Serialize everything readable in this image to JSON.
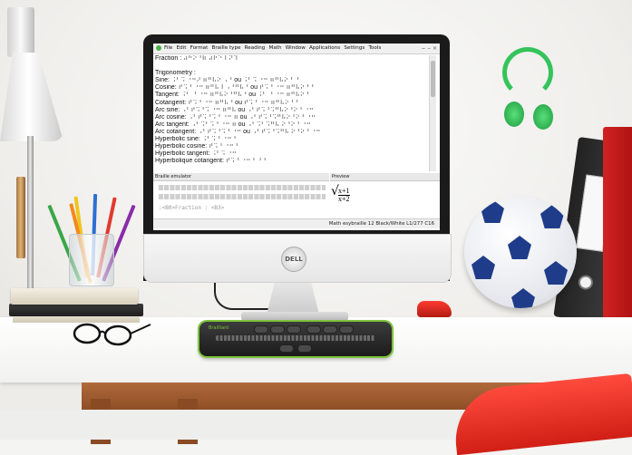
{
  "app": {
    "menu": [
      "File",
      "Edit",
      "Format",
      "Braille type",
      "Reading",
      "Math",
      "Window",
      "Applications",
      "Settings",
      "Tools"
    ],
    "window_controls": "− ‒ ×"
  },
  "editor_lines": [
    "Fraction : ⠴⠓⠕⠘⠷ ⠴⠗⠑⠸ ⠝⠹",
    "",
    "Trigonometry :",
    "Sine: ⠨⠃⠩ ⠐⠒⠜ ⠶⠛⠧⠕ ⠠⠘ ou ⠨⠃⠩ ⠐⠒ ⠶⠛⠧⠕⠘ ⠘",
    "Cosine: ⠞⠩⠘ ⠐⠒ ⠶⠛⠧⠸ ⠠⠘⠛⠧⠘ ou ⠞⠩⠘ ⠐⠒ ⠶⠛⠧⠕⠘⠘",
    "Tangent: ⠨⠃ ⠘ ⠐⠒ ⠶⠛⠧⠕⠘⠛⠧⠘ ou ⠨⠃ ⠘ ⠐⠒ ⠶⠛⠧⠕⠘",
    "Cotangent: ⠞⠩⠘ ⠐⠒ ⠶⠛⠧⠘ ou ⠞⠩⠘ ⠐⠒ ⠶⠛⠧⠕⠘⠘",
    "Arc sine: ⠠⠃⠞⠩⠘⠩ ⠐⠒ ⠶⠛⠧ ou ⠠⠃⠞⠩⠘⠩⠛⠧⠕⠘⠕⠘ ⠐⠒",
    "Arc cosine: ⠠⠃⠞⠩⠘⠩⠘ ⠐⠒ ⠶ ou ⠠⠃⠞⠩⠘⠩⠛⠧⠕⠘⠕⠘ ⠐⠒",
    "Arc tangent: ⠠⠃⠩⠃⠩⠘ ⠐⠒ ⠶ ou ⠠⠃⠩⠃⠩⠛⠧ ⠕⠘⠕⠘ ⠐⠒",
    "Arc cotangent: ⠠⠃⠞⠩⠘⠩⠘ ⠐⠒ ou ⠠⠃⠞⠩⠘⠩⠛⠧ ⠕⠘⠕⠘ ⠐⠒",
    "Hyperbolic sine: ⠨⠃⠩⠘ ⠐⠒⠘",
    "Hyperbolic cosine: ⠞⠩⠘ ⠐⠒⠘",
    "Hyperbolic tangent: ⠨⠃⠩ ⠐⠒",
    "Hyperbolique cotangent: ⠞⠩⠘ ⠐⠒⠘ ⠘⠘"
  ],
  "braille_emulator": {
    "title": "Braille emulator",
    "text": ":<B0>Fraction : <B3>"
  },
  "preview": {
    "title": "Preview",
    "numerator": "x+1",
    "denominator": "x+2"
  },
  "status": "Math esybraille 12 Black/White L1/277 C16",
  "device_brand": "Brailliant"
}
